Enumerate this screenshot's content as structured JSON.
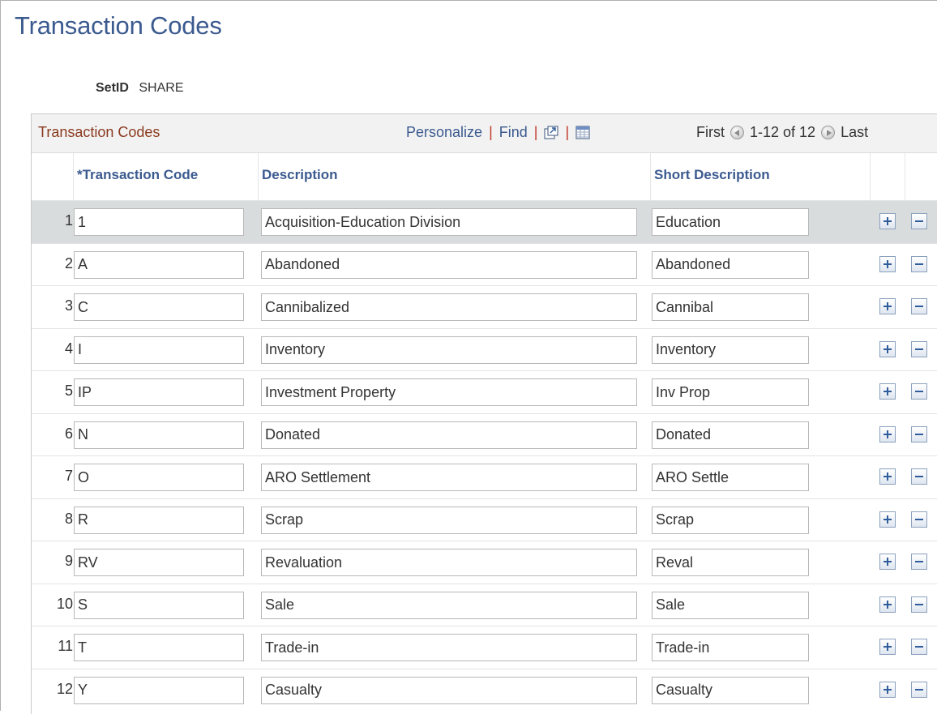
{
  "page": {
    "title": "Transaction Codes"
  },
  "setid": {
    "label": "SetID",
    "value": "SHARE"
  },
  "grid": {
    "title": "Transaction Codes",
    "personalize_label": "Personalize",
    "find_label": "Find",
    "separator": "|",
    "first_label": "First",
    "range_label": "1-12 of 12",
    "last_label": "Last",
    "columns": {
      "code": "*Transaction Code",
      "description": "Description",
      "short_description": "Short Description"
    },
    "rows": [
      {
        "num": "1",
        "code": "1",
        "description": "Acquisition-Education Division",
        "short": "Education"
      },
      {
        "num": "2",
        "code": "A",
        "description": "Abandoned",
        "short": "Abandoned"
      },
      {
        "num": "3",
        "code": "C",
        "description": "Cannibalized",
        "short": "Cannibal"
      },
      {
        "num": "4",
        "code": "I",
        "description": "Inventory",
        "short": "Inventory"
      },
      {
        "num": "5",
        "code": "IP",
        "description": "Investment Property",
        "short": "Inv Prop"
      },
      {
        "num": "6",
        "code": "N",
        "description": "Donated",
        "short": "Donated"
      },
      {
        "num": "7",
        "code": "O",
        "description": "ARO Settlement",
        "short": "ARO Settle"
      },
      {
        "num": "8",
        "code": "R",
        "description": "Scrap",
        "short": "Scrap"
      },
      {
        "num": "9",
        "code": "RV",
        "description": "Revaluation",
        "short": "Reval"
      },
      {
        "num": "10",
        "code": "S",
        "description": "Sale",
        "short": "Sale"
      },
      {
        "num": "11",
        "code": "T",
        "description": "Trade-in",
        "short": "Trade-in"
      },
      {
        "num": "12",
        "code": "Y",
        "description": "Casualty",
        "short": "Casualty"
      }
    ],
    "selected_row": 0
  },
  "icons": {
    "zoom": "new-window-icon",
    "download": "spreadsheet-icon",
    "prev": "previous-arrow-icon",
    "next": "next-arrow-icon",
    "add": "add-row-icon",
    "delete": "delete-row-icon"
  },
  "colors": {
    "title": "#3b5a8f",
    "grid_title": "#8b3a1f",
    "link": "#3b5a8f",
    "selected_row": "#d9dcdc"
  }
}
